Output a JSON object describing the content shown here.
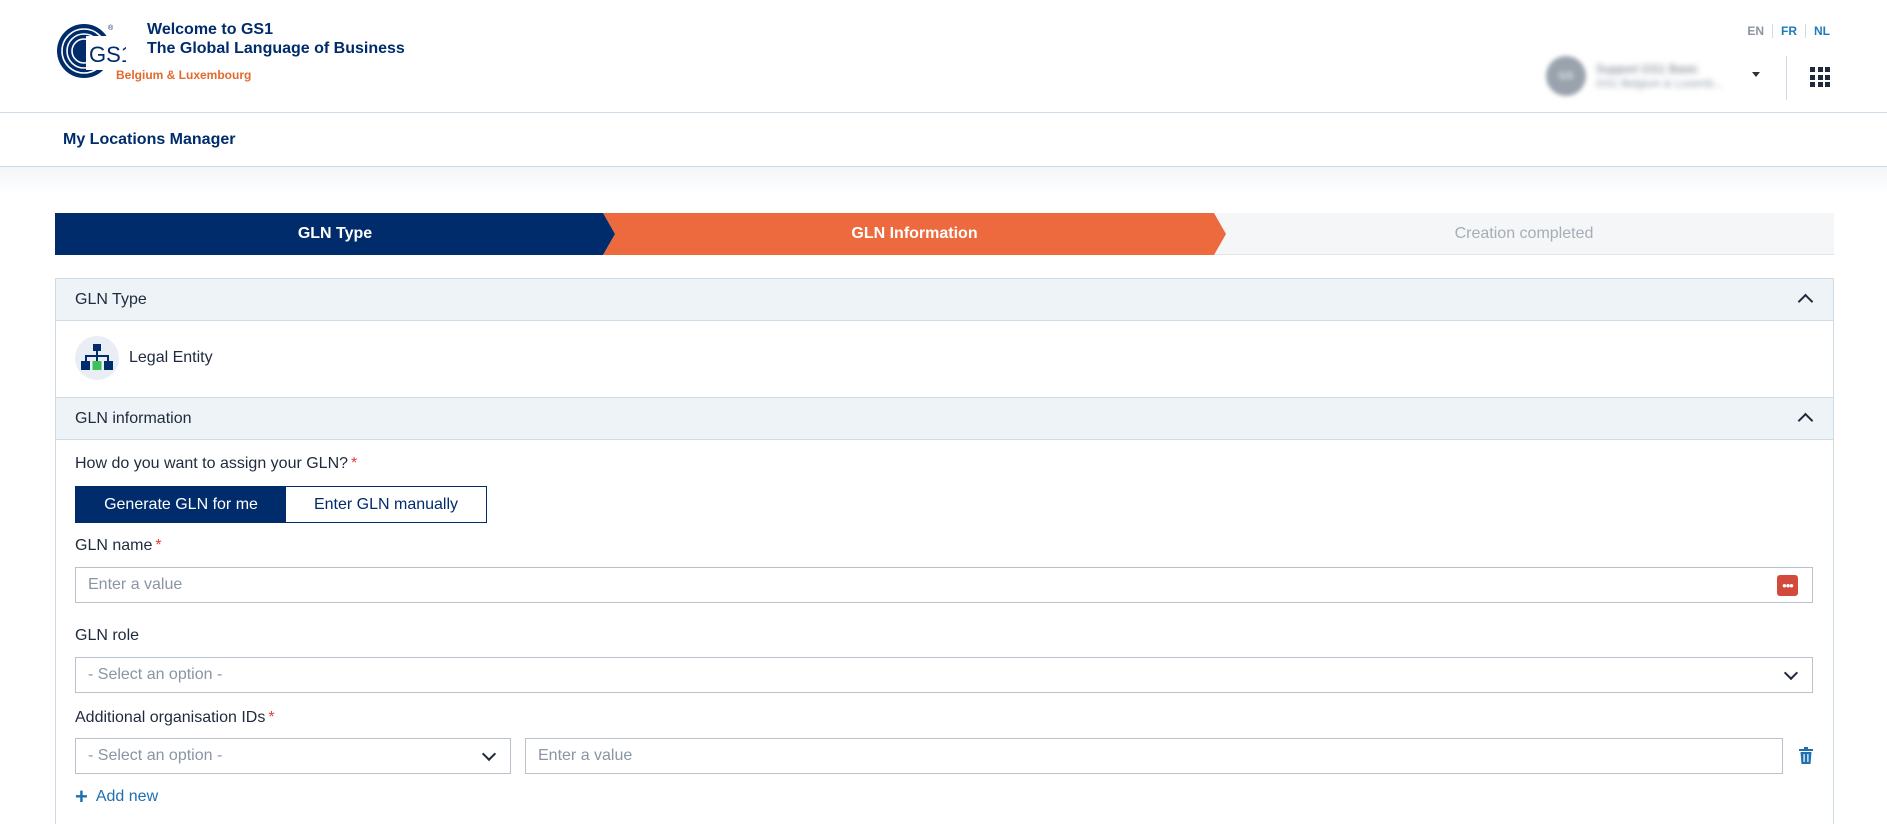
{
  "header": {
    "welcome": "Welcome to GS1",
    "tagline": "The Global Language of Business",
    "region": "Belgium & Luxembourg",
    "logo_text": "GS1",
    "languages": [
      {
        "code": "EN",
        "active": false
      },
      {
        "code": "FR",
        "active": true
      },
      {
        "code": "NL",
        "active": false
      }
    ],
    "user": {
      "initials": "GS",
      "name": "Support GS1 Basic",
      "org": "GS1 Belgium & Luxemb..."
    }
  },
  "subnav": {
    "title": "My Locations Manager"
  },
  "stepper": {
    "steps": [
      {
        "label": "GLN Type",
        "state": "done"
      },
      {
        "label": "GLN Information",
        "state": "active"
      },
      {
        "label": "Creation completed",
        "state": "pending"
      }
    ]
  },
  "gln_type_panel": {
    "title": "GLN Type",
    "selected_type": "Legal Entity",
    "icon": "org-chart-icon"
  },
  "gln_info_panel": {
    "title": "GLN information",
    "assign_label": "How do you want to assign your GLN?",
    "required_mark": "*",
    "toggle": {
      "generate": "Generate GLN for me",
      "manual": "Enter GLN manually",
      "selected": "generate"
    },
    "gln_name": {
      "label": "GLN name",
      "placeholder": "Enter a value"
    },
    "gln_role": {
      "label": "GLN role",
      "placeholder": "- Select an option -"
    },
    "additional_ids": {
      "label": "Additional organisation IDs",
      "type_placeholder": "- Select an option -",
      "value_placeholder": "Enter a value"
    },
    "add_new": "Add new"
  },
  "colors": {
    "navy": "#002c6c",
    "orange": "#ec6a3d",
    "link": "#1d6fb0",
    "required": "#e03c3c"
  }
}
